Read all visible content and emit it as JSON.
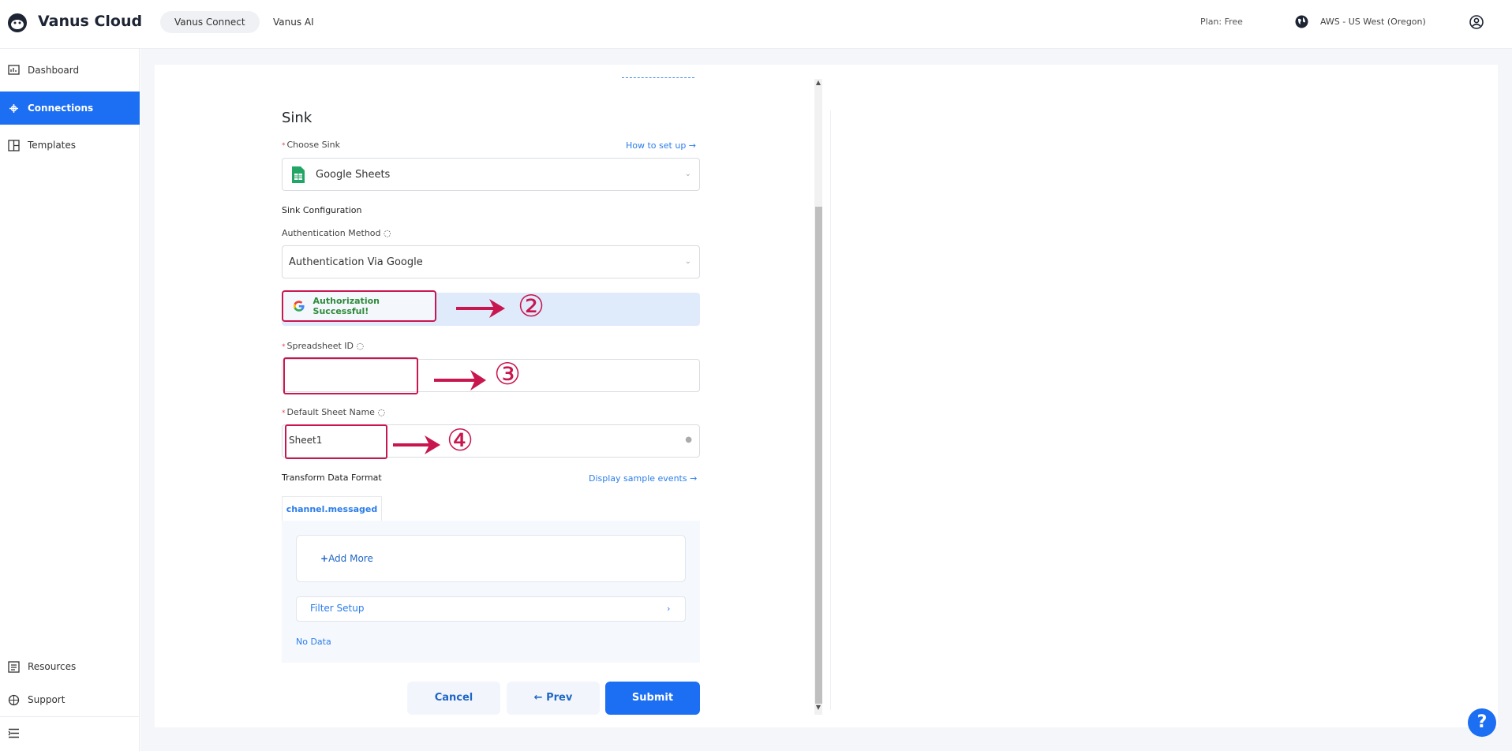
{
  "header": {
    "brand": "Vanus Cloud",
    "tabs": [
      {
        "label": "Vanus Connect"
      },
      {
        "label": "Vanus AI"
      }
    ],
    "plan": "Plan: Free",
    "region": "AWS - US West (Oregon)"
  },
  "sidebar": {
    "items": [
      {
        "label": "Dashboard",
        "icon": "dashboard-icon"
      },
      {
        "label": "Connections",
        "icon": "connections-icon"
      },
      {
        "label": "Templates",
        "icon": "templates-icon"
      }
    ],
    "bottom_items": [
      {
        "label": "Resources",
        "icon": "resources-icon"
      },
      {
        "label": "Support",
        "icon": "support-icon"
      }
    ]
  },
  "form": {
    "title": "Sink",
    "choose_sink_label": "Choose Sink",
    "how_to_link": "How to set up",
    "sink_value": "Google Sheets",
    "sink_config_label": "Sink Configuration",
    "auth_method_label": "Authentication Method",
    "auth_method_value": "Authentication Via Google",
    "auth_status": "Authorization Successful!",
    "spreadsheet_label": "Spreadsheet ID",
    "spreadsheet_value": "",
    "sheet_name_label": "Default Sheet Name",
    "sheet_name_value": "Sheet1",
    "transform_label": "Transform Data Format",
    "display_events_link": "Display sample events",
    "event_tab": "channel.messaged",
    "add_more": "Add More",
    "filter_setup": "Filter Setup",
    "no_data": "No Data"
  },
  "annotations": {
    "step2": "②",
    "step3": "③",
    "step4": "④"
  },
  "buttons": {
    "cancel": "Cancel",
    "prev": "Prev",
    "submit": "Submit"
  },
  "help": "?",
  "colors": {
    "primary": "#1c6ef2",
    "annotation": "#c8174f",
    "success": "#2f8a3a"
  }
}
